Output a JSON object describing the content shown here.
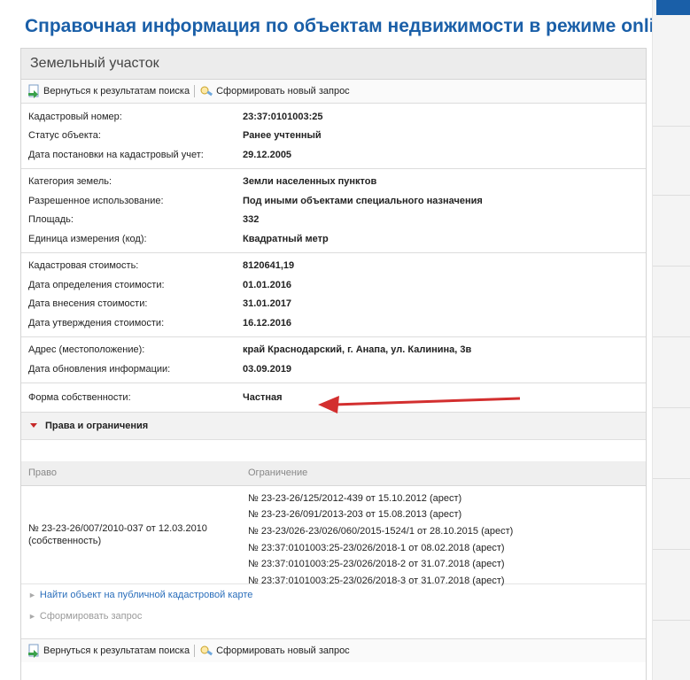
{
  "page": {
    "title": "Справочная информация по объектам недвижимости в режиме online"
  },
  "card": {
    "title": "Земельный участок"
  },
  "toolbar": {
    "back_label": "Вернуться к результатам поиска",
    "new_request_label": "Сформировать новый запрос"
  },
  "sections": [
    {
      "rows": [
        {
          "label": "Кадастровый номер:",
          "value": "23:37:0101003:25"
        },
        {
          "label": "Статус объекта:",
          "value": "Ранее учтенный"
        },
        {
          "label": "Дата постановки на кадастровый учет:",
          "value": "29.12.2005"
        }
      ]
    },
    {
      "rows": [
        {
          "label": "Категория земель:",
          "value": "Земли населенных пунктов"
        },
        {
          "label": "Разрешенное использование:",
          "value": "Под иными объектами специального назначения"
        },
        {
          "label": "Площадь:",
          "value": "332"
        },
        {
          "label": "Единица измерения (код):",
          "value": "Квадратный метр"
        }
      ]
    },
    {
      "rows": [
        {
          "label": "Кадастровая стоимость:",
          "value": "8120641,19"
        },
        {
          "label": "Дата определения стоимости:",
          "value": "01.01.2016"
        },
        {
          "label": "Дата внесения стоимости:",
          "value": "31.01.2017"
        },
        {
          "label": "Дата утверждения стоимости:",
          "value": "16.12.2016"
        }
      ]
    },
    {
      "rows": [
        {
          "label": "Адрес (местоположение):",
          "value": "край Краснодарский, г. Анапа, ул. Калинина, 3в"
        },
        {
          "label": "Дата обновления информации:",
          "value": "03.09.2019"
        }
      ]
    }
  ],
  "ownership": {
    "label": "Форма собственности:",
    "value": "Частная"
  },
  "rights": {
    "title": "Права и ограничения",
    "col_right": "Право",
    "col_limit": "Ограничение",
    "right_line1": "№ 23-23-26/007/2010-037  от 12.03.2010",
    "right_line2": "(собственность)",
    "limits": [
      "№ 23-23-26/125/2012-439  от 15.10.2012  (арест)",
      "№ 23-23-26/091/2013-203  от 15.08.2013  (арест)",
      "№ 23-23/026-23/026/060/2015-1524/1  от 28.10.2015  (арест)",
      "№ 23:37:0101003:25-23/026/2018-1  от 08.02.2018  (арест)",
      "№ 23:37:0101003:25-23/026/2018-2  от 31.07.2018  (арест)",
      "№ 23:37:0101003:25-23/026/2018-3  от 31.07.2018  (арест)"
    ]
  },
  "links": {
    "public_map": "Найти объект на публичной кадастровой карте",
    "form_request": "Сформировать запрос"
  },
  "colors": {
    "title_blue": "#1a5fa8",
    "arrow_red": "#d32f2f",
    "link_blue": "#2a6ebb"
  }
}
